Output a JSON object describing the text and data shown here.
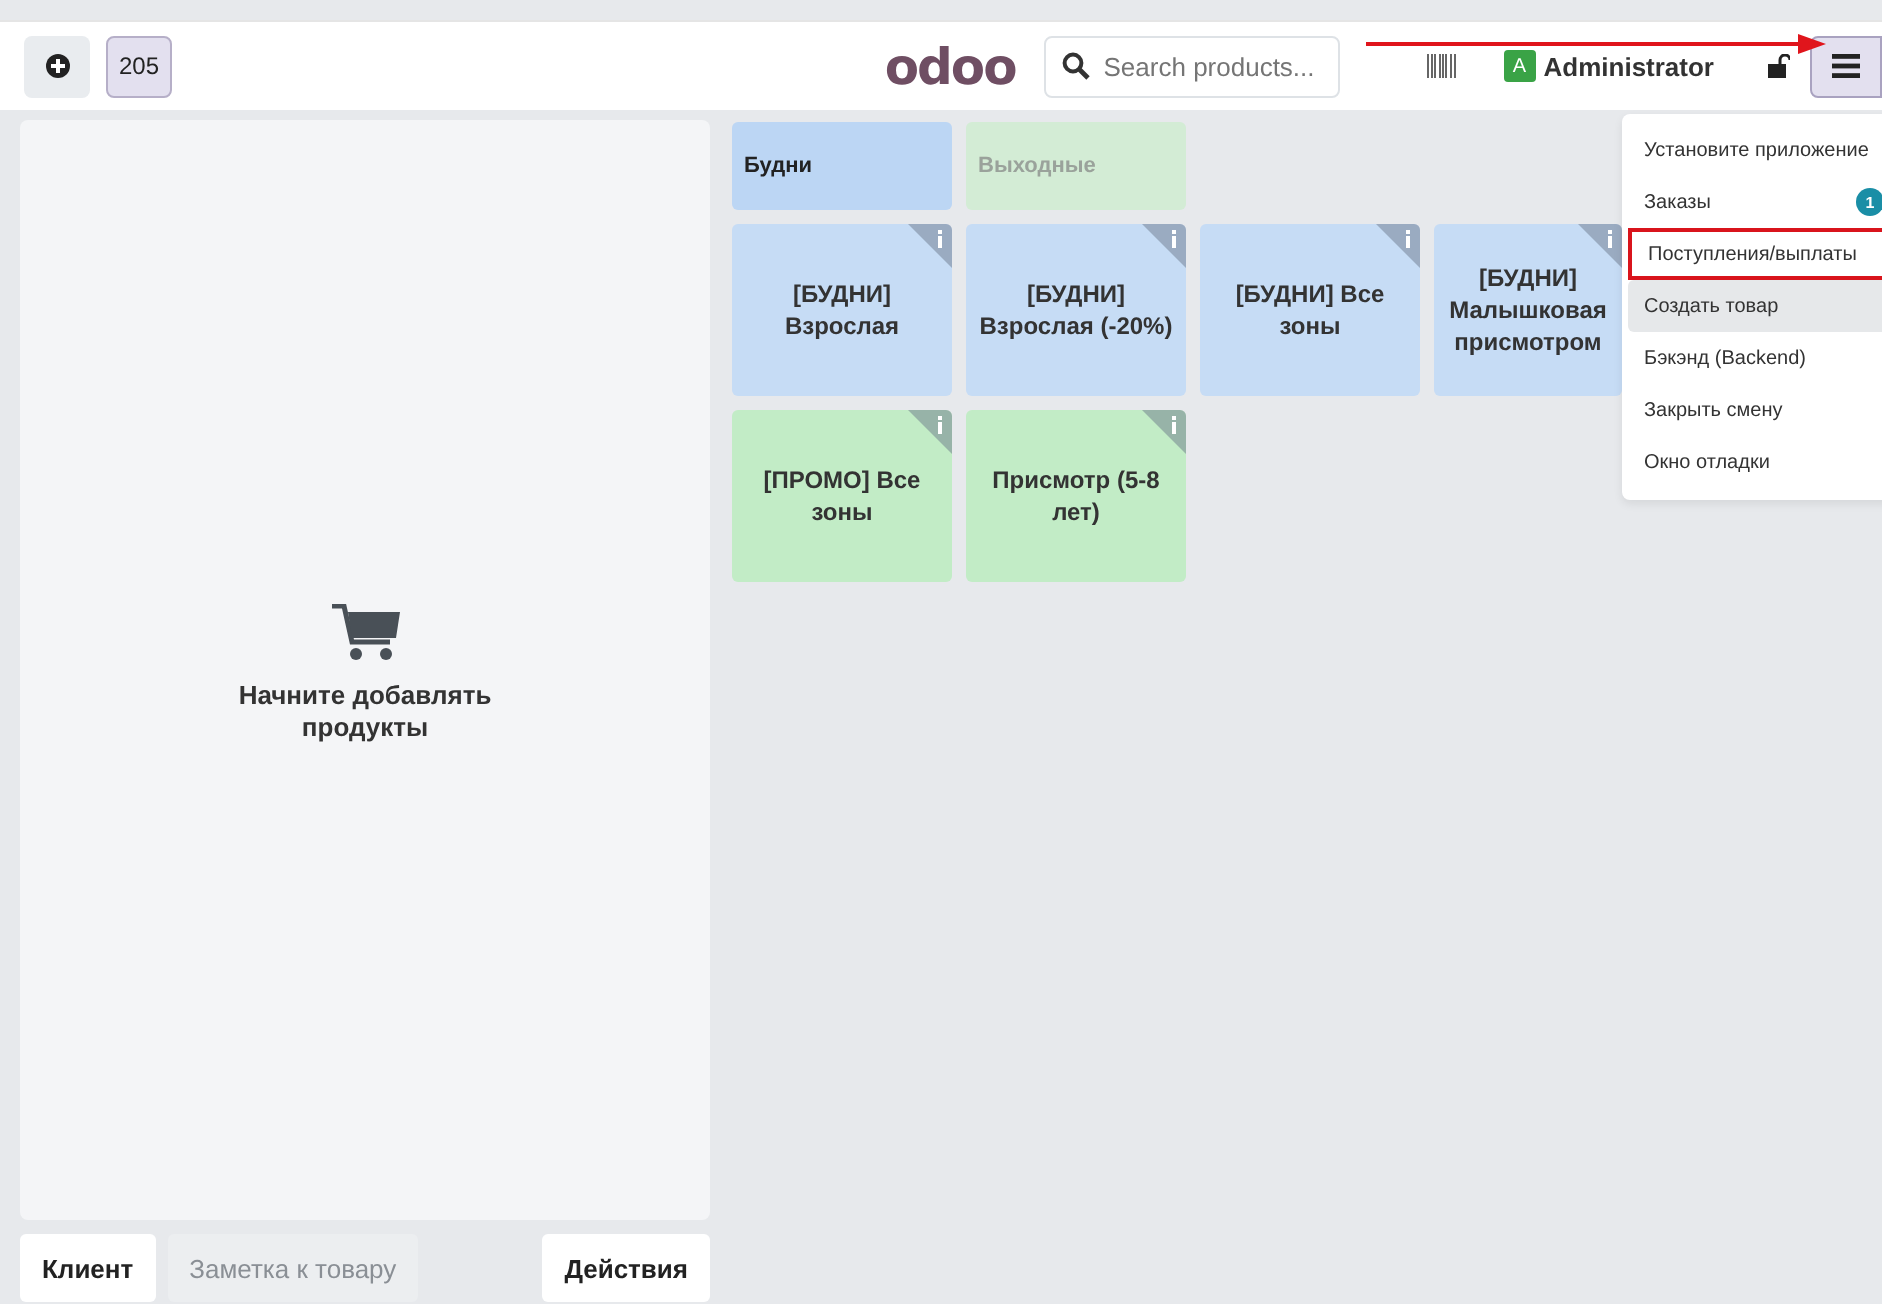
{
  "header": {
    "order_count": "205",
    "logo": "odoo",
    "search": {
      "placeholder": "Search products..."
    },
    "user": {
      "initial": "A",
      "name": "Administrator"
    },
    "menu_open": true
  },
  "order": {
    "empty_message": "Начните добавлять продукты",
    "buttons": [
      {
        "label": "Клиент",
        "kind": "button"
      },
      {
        "label": "Заметка к товару",
        "kind": "muted"
      },
      {
        "label": "Действия",
        "kind": "button"
      }
    ]
  },
  "categories": [
    {
      "label": "Будни",
      "selected": true,
      "color": "#bcd6f4"
    },
    {
      "label": "Выходные",
      "selected": false,
      "color": "#d3ecd5"
    }
  ],
  "products": [
    {
      "lines": [
        "[БУДНИ]",
        "Взрослая"
      ],
      "color": "#c6dcf5"
    },
    {
      "lines": [
        "[БУДНИ]",
        "Взрослая (-20%)"
      ],
      "color": "#c6dcf5"
    },
    {
      "lines": [
        "[БУДНИ] Все",
        "зоны"
      ],
      "color": "#c6dcf5"
    },
    {
      "lines": [
        "[БУДНИ]",
        "Малышковая",
        "присмотром"
      ],
      "color": "#c6dcf5"
    },
    {
      "lines": [
        "[ПРОМО] Все",
        "зоны"
      ],
      "color": "#c2ecc6"
    },
    {
      "lines": [
        "Присмотр (5-8",
        "лет)"
      ],
      "color": "#c2ecc6"
    }
  ],
  "menu": [
    {
      "label": "Установите приложение",
      "highlighted": false,
      "hovered": false
    },
    {
      "label": "Заказы",
      "badge": "1",
      "highlighted": false,
      "hovered": false
    },
    {
      "label": "Поступления/выплаты",
      "highlighted": true,
      "hovered": false
    },
    {
      "label": "Создать товар",
      "highlighted": false,
      "hovered": true
    },
    {
      "label": "Бэкэнд (Backend)",
      "highlighted": false,
      "hovered": false
    },
    {
      "label": "Закрыть смену",
      "highlighted": false,
      "hovered": false
    },
    {
      "label": "Окно отладки",
      "highlighted": false,
      "hovered": false
    }
  ]
}
